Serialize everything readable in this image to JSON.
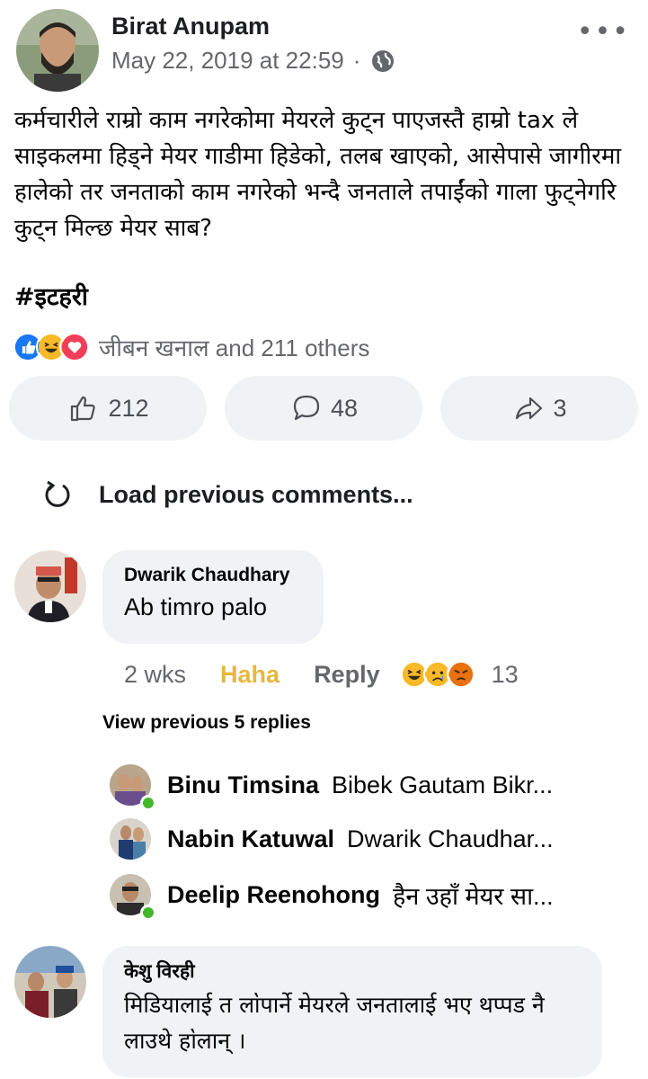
{
  "post": {
    "author": "Birat Anupam",
    "timestamp": "May 22, 2019 at 22:59",
    "separator": "·",
    "privacy_icon": "globe-icon",
    "more_label": "•••",
    "text": "कर्मचारीले राम्रो काम नगरेकोमा मेयरले कुट्न पाएजस्तै हाम्रो tax ले साइकलमा हिड्ने मेयर गाडीमा हिडेको, तलब खाएको, आसेपासे जागीरमा हालेको तर जनताको  काम नगरेको भन्दै जनताले तपाईंको गाला फुट्नेगरि कुट्न मिल्छ मेयर साब?",
    "hashtag": "#इटहरी",
    "reactions_text": "जीबन खनाल and 211 others",
    "reaction_icons": [
      "like-icon",
      "haha-icon",
      "love-icon"
    ]
  },
  "actions": {
    "like_count": "212",
    "comment_count": "48",
    "share_count": "3"
  },
  "load_previous": "Load previous comments...",
  "comments": [
    {
      "author": "Dwarik Chaudhary",
      "text": "Ab timro palo",
      "time": "2 wks",
      "reaction_label": "Haha",
      "reply_label": "Reply",
      "reaction_count": "13"
    },
    {
      "author": "केशु विरही",
      "text": "मिडियालाई त ला॓पार्ने मेयरले जनतालाई भए थप्पड नै लाउथे हा॓लान् ।"
    }
  ],
  "view_previous_replies": "View previous 5 replies",
  "replies": [
    {
      "author": "Binu Timsina",
      "text": "Bibek Gautam Bikr...",
      "online": true
    },
    {
      "author": "Nabin Katuwal",
      "text": "Dwarik Chaudhar...",
      "online": false
    },
    {
      "author": "Deelip Reenohong",
      "text": "हैन उहाँ मेयर सा...",
      "online": true
    }
  ],
  "colors": {
    "like_blue": "#1877f2",
    "haha_yellow": "#f7b928",
    "love_red": "#f33e58",
    "haha_label": "#e8b63e",
    "online_green": "#42b72a"
  }
}
